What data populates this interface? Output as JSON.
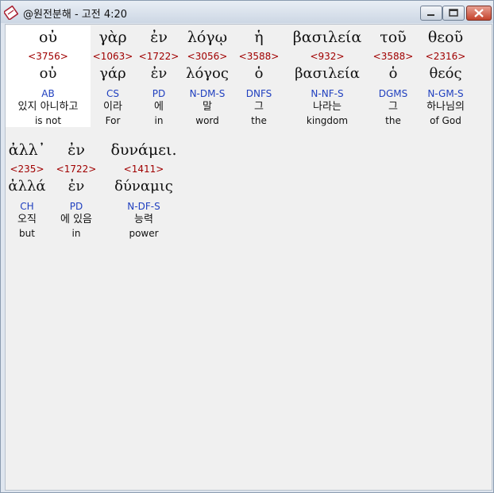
{
  "window": {
    "title": "@원전분해 - 고전 4:20",
    "icons": {
      "app": "book-icon",
      "minimize": "minimize-icon",
      "maximize": "maximize-icon",
      "close": "close-icon"
    }
  },
  "words": [
    {
      "greek": "οὐ",
      "strong": "<3756>",
      "lemma": "οὐ",
      "parse": "AB",
      "kor": "있지 아니하고",
      "eng": "is not",
      "highlighted": true
    },
    {
      "greek": "γὰρ",
      "strong": "<1063>",
      "lemma": "γάρ",
      "parse": "CS",
      "kor": "이라",
      "eng": "For"
    },
    {
      "greek": "ἐν",
      "strong": "<1722>",
      "lemma": "ἐν",
      "parse": "PD",
      "kor": "에",
      "eng": "in"
    },
    {
      "greek": "λόγῳ",
      "strong": "<3056>",
      "lemma": "λόγος",
      "parse": "N-DM-S",
      "kor": "말",
      "eng": "word"
    },
    {
      "greek": "ἡ",
      "strong": "<3588>",
      "lemma": "ὁ",
      "parse": "DNFS",
      "kor": "그",
      "eng": "the"
    },
    {
      "greek": "βασιλεία",
      "strong": "<932>",
      "lemma": "βασιλεία",
      "parse": "N-NF-S",
      "kor": "나라는",
      "eng": "kingdom"
    },
    {
      "greek": "τοῦ",
      "strong": "<3588>",
      "lemma": "ὁ",
      "parse": "DGMS",
      "kor": "그",
      "eng": "the"
    },
    {
      "greek": "θεοῦ",
      "strong": "<2316>",
      "lemma": "θεός",
      "parse": "N-GM-S",
      "kor": "하나님의",
      "eng": "of God"
    },
    {
      "greek": "ἀλλ᾽",
      "strong": "<235>",
      "lemma": "ἀλλά",
      "parse": "CH",
      "kor": "오직",
      "eng": "but"
    },
    {
      "greek": "ἐν",
      "strong": "<1722>",
      "lemma": "ἐν",
      "parse": "PD",
      "kor": "에 있음",
      "eng": "in"
    },
    {
      "greek": "δυνάμει.",
      "strong": "<1411>",
      "lemma": "δύναμις",
      "parse": "N-DF-S",
      "kor": "능력",
      "eng": "power"
    }
  ]
}
